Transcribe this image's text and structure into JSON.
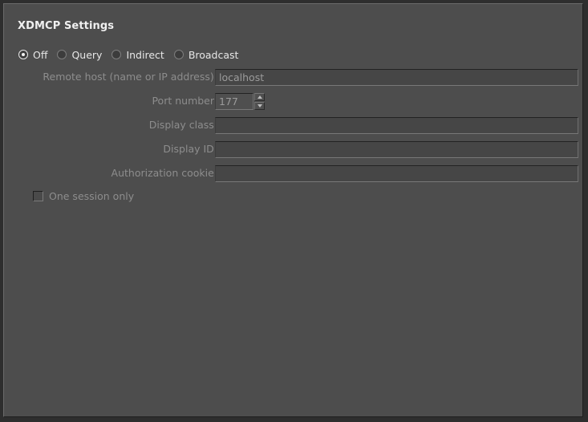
{
  "panel": {
    "title": "XDMCP Settings"
  },
  "mode": {
    "selected": "Off",
    "options": [
      {
        "label": "Off",
        "checked": true
      },
      {
        "label": "Query",
        "checked": false
      },
      {
        "label": "Indirect",
        "checked": false
      },
      {
        "label": "Broadcast",
        "checked": false
      }
    ]
  },
  "fields": [
    {
      "name": "remote-host",
      "label": "Remote host (name or IP address):",
      "value": "localhost",
      "placeholder": "",
      "disabled": true
    },
    {
      "name": "port-number",
      "label": "Port number:",
      "value": "177",
      "placeholder": "",
      "disabled": true
    },
    {
      "name": "display-class",
      "label": "Display class:",
      "value": "",
      "placeholder": "",
      "disabled": true
    },
    {
      "name": "display-id",
      "label": "Display ID:",
      "value": "",
      "placeholder": "",
      "disabled": true
    },
    {
      "name": "authorization-cookie",
      "label": "Authorization cookie:",
      "value": "",
      "placeholder": "",
      "disabled": true
    }
  ],
  "spinner": {
    "up_icon": "triangle-up-icon",
    "down_icon": "triangle-down-icon"
  },
  "one_session": {
    "label": "One session only",
    "checked": false,
    "disabled": true
  },
  "colors": {
    "panel_background": "#4d4d4d",
    "window_background": "#2e2e2e",
    "field_background": "#464646",
    "title_text": "#f0f0f0",
    "enabled_text": "#e6e6e6",
    "disabled_text": "#8d8d8d",
    "field_text": "#9b9b9b"
  }
}
